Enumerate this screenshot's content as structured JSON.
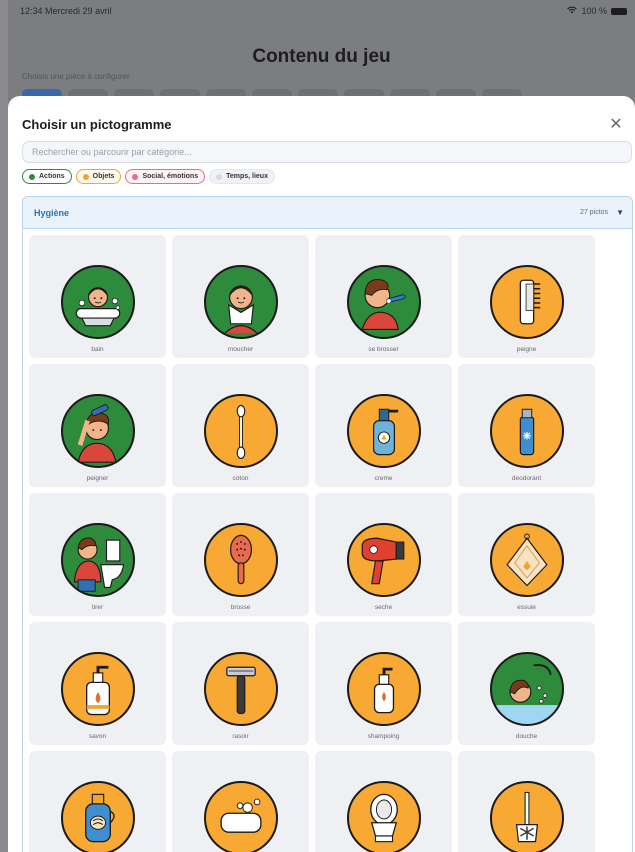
{
  "status_bar": {
    "time": "12:34",
    "date": "Mercredi 29 avril",
    "battery": "100 %"
  },
  "background": {
    "title": "Contenu du jeu",
    "subtitle": "Choisis une pièce à configurer"
  },
  "sheet": {
    "title": "Choisir un pictogramme",
    "close_label": "✕",
    "search_placeholder": "Rechercher ou parcourir par catégorie...",
    "chips": [
      {
        "label": "Actions",
        "color": "#2f8a3c"
      },
      {
        "label": "Objets",
        "color": "#f0a52b"
      },
      {
        "label": "Social, émotions",
        "color": "#ea6b8d"
      },
      {
        "label": "Temps, lieux",
        "color": "#d7d9de"
      }
    ]
  },
  "category": {
    "name": "Hygiène",
    "count": "27 pictos",
    "caret": "▼",
    "items": [
      {
        "label": "bain",
        "kind": "action",
        "icon": "bath-icon"
      },
      {
        "label": "moucher",
        "kind": "action",
        "icon": "blow-nose-icon"
      },
      {
        "label": "se brosser",
        "kind": "action",
        "icon": "brush-teeth-icon"
      },
      {
        "label": "peigne",
        "kind": "objet",
        "icon": "comb-icon"
      },
      {
        "label": "peigner",
        "kind": "action",
        "icon": "combing-hair-icon"
      },
      {
        "label": "coton",
        "kind": "objet",
        "icon": "cotton-swab-icon"
      },
      {
        "label": "creme",
        "kind": "objet",
        "icon": "cream-bottle-icon"
      },
      {
        "label": "deodorant",
        "kind": "objet",
        "icon": "deodorant-icon"
      },
      {
        "label": "tirer",
        "kind": "action",
        "icon": "flush-toilet-icon"
      },
      {
        "label": "brosse",
        "kind": "objet",
        "icon": "hairbrush-icon"
      },
      {
        "label": "seche",
        "kind": "objet",
        "icon": "hair-dryer-icon"
      },
      {
        "label": "essuie",
        "kind": "objet",
        "icon": "towel-icon"
      },
      {
        "label": "savon",
        "kind": "objet",
        "icon": "soap-pump-icon"
      },
      {
        "label": "rasoir",
        "kind": "objet",
        "icon": "razor-icon"
      },
      {
        "label": "shampoing",
        "kind": "objet",
        "icon": "shampoo-icon"
      },
      {
        "label": "douche",
        "kind": "action",
        "icon": "shower-icon"
      },
      {
        "label": "",
        "kind": "objet",
        "icon": "bottle-icon"
      },
      {
        "label": "",
        "kind": "objet",
        "icon": "soap-bar-icon"
      },
      {
        "label": "",
        "kind": "objet",
        "icon": "toilet-icon"
      },
      {
        "label": "",
        "kind": "objet",
        "icon": "toilet-brush-icon"
      }
    ]
  }
}
